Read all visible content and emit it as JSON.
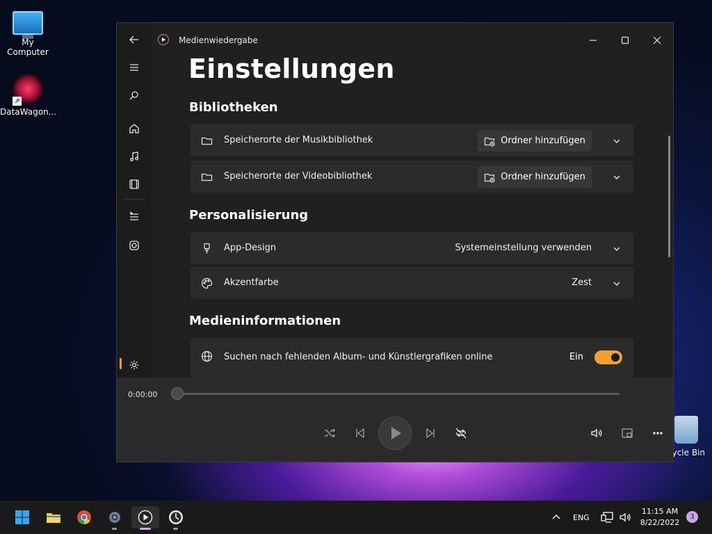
{
  "desktop": {
    "icons": [
      {
        "label": "My Computer"
      },
      {
        "label": "DataWagon..."
      },
      {
        "label": "cycle Bin"
      }
    ]
  },
  "window": {
    "app_title": "Medienwiedergabe",
    "page_title": "Einstellungen",
    "sections": {
      "libraries": {
        "heading": "Bibliotheken",
        "music_label": "Speicherorte der Musikbibliothek",
        "video_label": "Speicherorte der Videobibliothek",
        "add_folder_label": "Ordner hinzufügen"
      },
      "personalization": {
        "heading": "Personalisierung",
        "app_design_label": "App-Design",
        "app_design_value": "Systemeinstellung verwenden",
        "accent_label": "Akzentfarbe",
        "accent_value": "Zest"
      },
      "media_info": {
        "heading": "Medieninformationen",
        "search_art_label": "Suchen nach fehlenden Album- und Künstlergrafiken online",
        "search_art_state": "Ein",
        "search_art_on": true
      }
    },
    "player": {
      "time": "0:00:00",
      "progress": 0
    },
    "accent_color": "#f3a030"
  },
  "taskbar": {
    "language": "ENG",
    "time": "11:15 AM",
    "date": "8/22/2022",
    "notification_count": "3"
  }
}
